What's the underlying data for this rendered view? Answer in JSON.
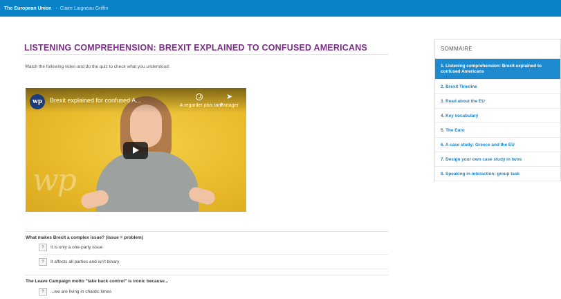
{
  "topbar": {
    "site": "The European Union",
    "separator": "-",
    "author": "Claire Laigneau Griffin"
  },
  "main": {
    "title": "LISTENING COMPREHENSION: BREXIT EXPLAINED TO CONFUSED AMERICANS",
    "intro": "Watch the following video and do the quiz to check what you understood:"
  },
  "video": {
    "logo": "wp",
    "title": "Brexit explained for confused A...",
    "watch_later": "A regarder plus tard",
    "share": "Partager",
    "watermark": "wp"
  },
  "quiz": [
    {
      "question": "What makes Brexit a complex issue?  (issue = problem)",
      "options": [
        "It is only a one-party issue",
        "It affects all parties and isn't binary"
      ]
    },
    {
      "question": "The Leave Campaign motto \"take back control\" is ironic because...",
      "options": [
        "...we are living in chaotic times"
      ]
    }
  ],
  "option_marker": "?",
  "sidebar": {
    "heading": "SOMMAIRE",
    "items": [
      "1. Listening comprehension: Brexit explained to confused Americans",
      "2. Brexit Timeline",
      "3. Read about the EU",
      "4. Key vocabulary",
      "5. The Euro",
      "6. A case study: Greece and the EU",
      "7. Design your own case study in twos",
      "8. Speaking in interaction: group task"
    ],
    "active_index": 0
  },
  "colors": {
    "topbar": "#0a82c8",
    "title": "#7a2f86",
    "link": "#1a84c8",
    "active": "#1e8bd0",
    "video_bg": "#e7b92a"
  }
}
